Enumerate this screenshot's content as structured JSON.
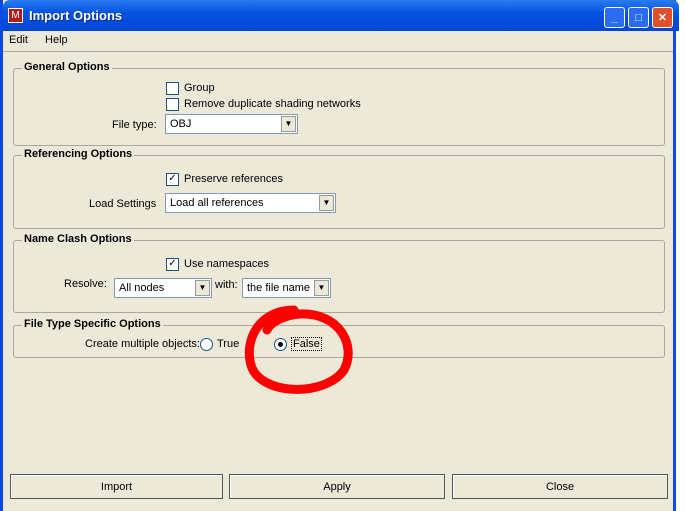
{
  "window": {
    "title": "Import Options"
  },
  "menu": [
    "Edit",
    "Help"
  ],
  "general": {
    "legend": "General Options",
    "group_label": "Group",
    "group_checked": false,
    "remove_dup_label": "Remove duplicate shading networks",
    "remove_dup_checked": false,
    "file_type_label": "File type:",
    "file_type_value": "OBJ"
  },
  "referencing": {
    "legend": "Referencing Options",
    "preserve_label": "Preserve references",
    "preserve_checked": true,
    "load_label": "Load Settings",
    "load_value": "Load all references"
  },
  "nameclash": {
    "legend": "Name Clash Options",
    "namespaces_label": "Use namespaces",
    "namespaces_checked": true,
    "resolve_label": "Resolve:",
    "resolve_value": "All nodes",
    "with_label": "with:",
    "with_value": "the file name"
  },
  "filetype": {
    "legend": "File Type Specific Options",
    "multiple_label": "Create multiple objects:",
    "true_label": "True",
    "false_label": "False",
    "selected": "False"
  },
  "buttons": {
    "import": "Import",
    "apply": "Apply",
    "close": "Close"
  },
  "colors": {
    "annotation": "#ff0000"
  }
}
